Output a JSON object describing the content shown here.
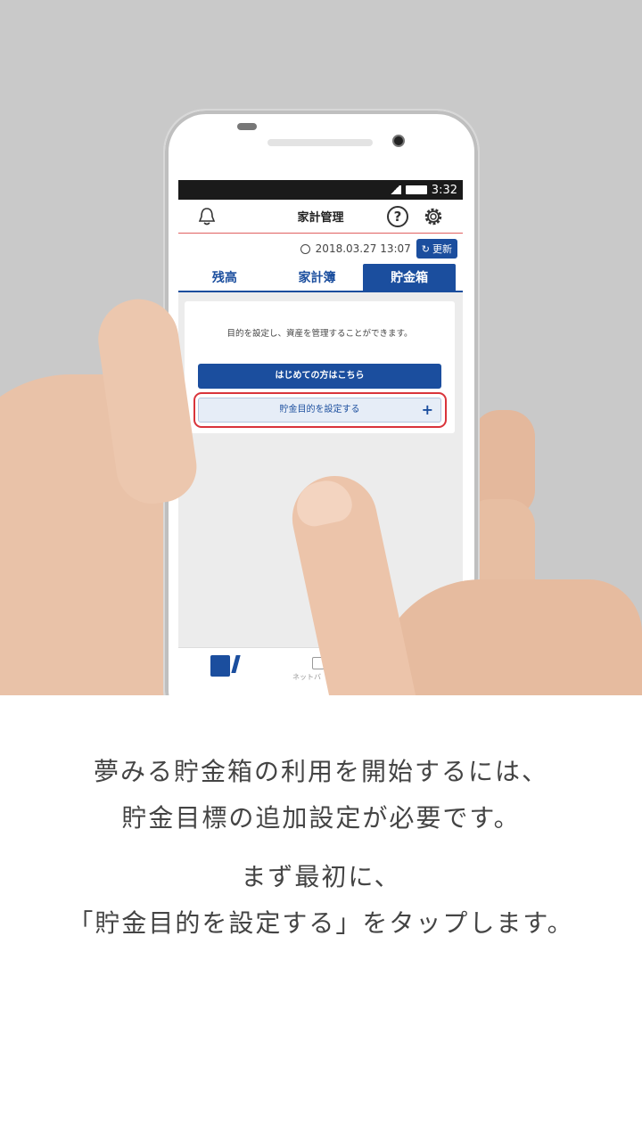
{
  "statusbar": {
    "time": "3:32"
  },
  "appbar": {
    "title": "家計管理",
    "help_symbol": "?"
  },
  "update": {
    "datetime": "2018.03.27 13:07",
    "button_label": "更新"
  },
  "tabs": [
    {
      "label": "残高",
      "active": false
    },
    {
      "label": "家計簿",
      "active": false
    },
    {
      "label": "貯金箱",
      "active": true
    }
  ],
  "card": {
    "description": "目的を設定し、資産を管理することができます。",
    "first_time_button": "はじめての方はこちら",
    "set_goal_button": "貯金目的を設定する",
    "plus_symbol": "+"
  },
  "bottom_nav": {
    "partial_label": "ネットバ"
  },
  "caption": {
    "line1": "夢みる貯金箱の利用を開始するには、",
    "line2": "貯金目標の追加設定が必要です。",
    "line3": "まず最初に、",
    "line4": "「貯金目的を設定する」をタップします。"
  },
  "colors": {
    "brand": "#1b4e9e",
    "highlight": "#d9343b"
  }
}
